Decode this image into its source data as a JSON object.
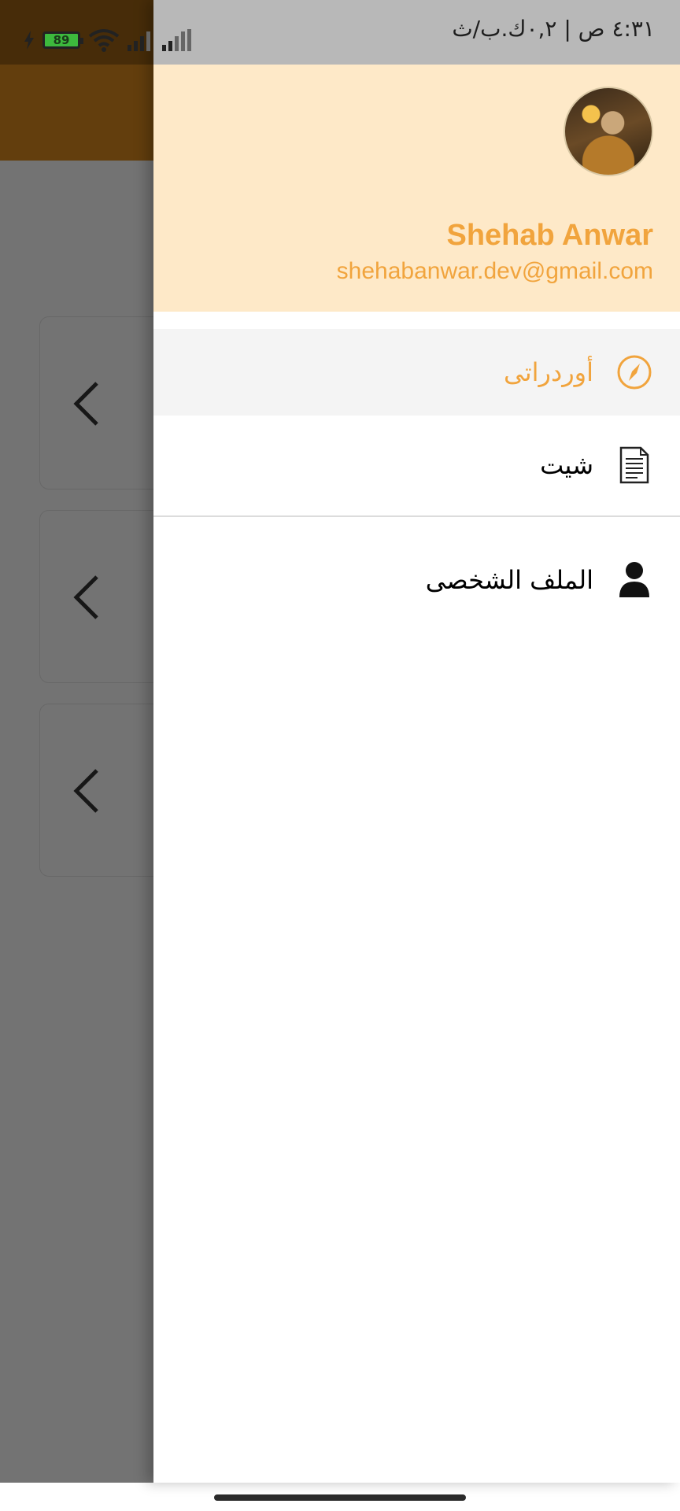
{
  "status_bar": {
    "time_text": "٤:٣١ ص | ٠,٢ك.ب/ث",
    "battery_level": "89"
  },
  "drawer": {
    "user": {
      "name": "Shehab Anwar",
      "email": "shehabanwar.dev@gmail.com"
    },
    "items": [
      {
        "label": "أوردراتى",
        "icon": "compass-icon",
        "selected": true
      },
      {
        "label": "شيت",
        "icon": "document-icon",
        "selected": false
      },
      {
        "label": "الملف الشخصى",
        "icon": "user-icon",
        "selected": false
      }
    ]
  },
  "colors": {
    "accent": "#f1a43d",
    "header_bg": "#fee9c8",
    "appbar": "#dc8b1e",
    "selected_item_bg": "#f4f4f4"
  }
}
